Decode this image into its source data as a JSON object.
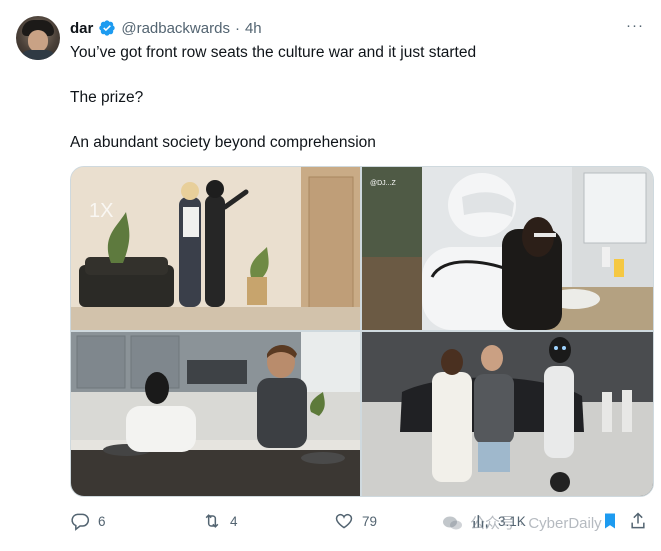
{
  "post": {
    "author_name": "dar",
    "handle": "@radbackwards",
    "separator": "·",
    "time": "4h",
    "more_label": "···",
    "paragraphs": [
      "You’ve got front row seats the culture war and it just started",
      "The prize?",
      "An abundant society beyond comprehension"
    ]
  },
  "media": {
    "tiles": [
      {
        "icon": "robot-showroom-image"
      },
      {
        "icon": "robot-brushing-teeth-image",
        "overlay_text": "@DJ...Z"
      },
      {
        "icon": "robot-kitchen-image"
      },
      {
        "icon": "robot-group-photo-image"
      }
    ]
  },
  "actions": {
    "replies": "6",
    "retweets": "4",
    "likes": "79",
    "views": "3.1K"
  },
  "watermark": {
    "text": "公众号 · CyberDaily"
  },
  "colors": {
    "text": "#0f1419",
    "secondary": "#536471",
    "verified": "#1d9bf0",
    "border": "#cfd9de"
  }
}
